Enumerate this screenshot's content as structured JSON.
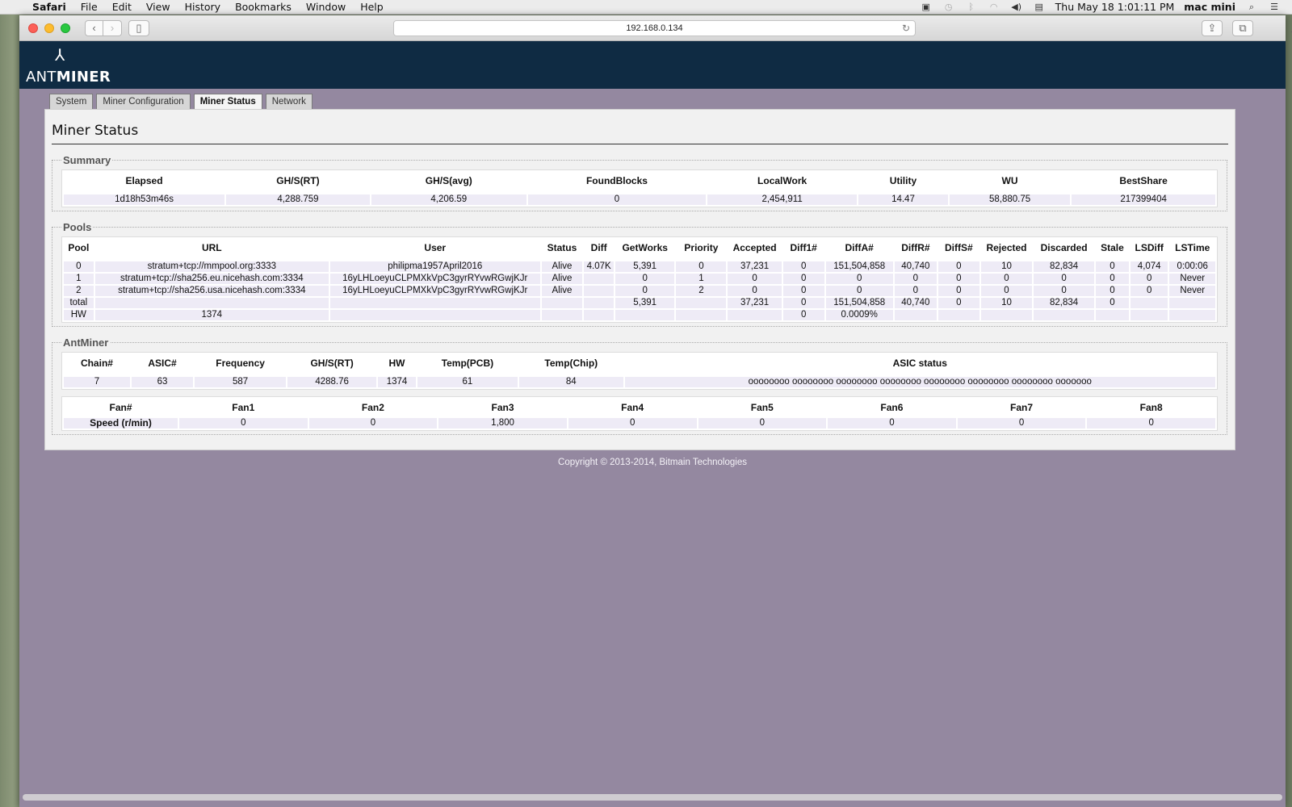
{
  "menubar": {
    "app": "Safari",
    "items": [
      "File",
      "Edit",
      "View",
      "History",
      "Bookmarks",
      "Window",
      "Help"
    ],
    "clock": "Thu May 18  1:01:11 PM",
    "user": "mac mini"
  },
  "browser": {
    "url": "192.168.0.134"
  },
  "nav": {
    "tabs": [
      "System",
      "Miner Configuration",
      "Miner Status",
      "Network"
    ],
    "active": "Miner Status"
  },
  "logo": {
    "mark": "⅄",
    "word_a": "ANT",
    "word_b": "MINER"
  },
  "page": {
    "title": "Miner Status",
    "summary": {
      "legend": "Summary",
      "headers": [
        "Elapsed",
        "GH/S(RT)",
        "GH/S(avg)",
        "FoundBlocks",
        "LocalWork",
        "Utility",
        "WU",
        "BestShare"
      ],
      "row": [
        "1d18h53m46s",
        "4,288.759",
        "4,206.59",
        "0",
        "2,454,911",
        "14.47",
        "58,880.75",
        "217399404"
      ]
    },
    "pools": {
      "legend": "Pools",
      "headers": [
        "Pool",
        "URL",
        "User",
        "Status",
        "Diff",
        "GetWorks",
        "Priority",
        "Accepted",
        "Diff1#",
        "DiffA#",
        "DiffR#",
        "DiffS#",
        "Rejected",
        "Discarded",
        "Stale",
        "LSDiff",
        "LSTime"
      ],
      "rows": [
        [
          "0",
          "stratum+tcp://mmpool.org:3333",
          "philipma1957April2016",
          "Alive",
          "4.07K",
          "5,391",
          "0",
          "37,231",
          "0",
          "151,504,858",
          "40,740",
          "0",
          "10",
          "82,834",
          "0",
          "4,074",
          "0:00:06"
        ],
        [
          "1",
          "stratum+tcp://sha256.eu.nicehash.com:3334",
          "16yLHLoeyuCLPMXkVpC3gyrRYvwRGwjKJr",
          "Alive",
          "",
          "0",
          "1",
          "0",
          "0",
          "0",
          "0",
          "0",
          "0",
          "0",
          "0",
          "0",
          "Never"
        ],
        [
          "2",
          "stratum+tcp://sha256.usa.nicehash.com:3334",
          "16yLHLoeyuCLPMXkVpC3gyrRYvwRGwjKJr",
          "Alive",
          "",
          "0",
          "2",
          "0",
          "0",
          "0",
          "0",
          "0",
          "0",
          "0",
          "0",
          "0",
          "Never"
        ],
        [
          "total",
          "",
          "",
          "",
          "",
          "5,391",
          "",
          "37,231",
          "0",
          "151,504,858",
          "40,740",
          "0",
          "10",
          "82,834",
          "0",
          "",
          ""
        ],
        [
          "HW",
          "1374",
          "",
          "",
          "",
          "",
          "",
          "",
          "0",
          "0.0009%",
          "",
          "",
          "",
          "",
          "",
          "",
          ""
        ]
      ]
    },
    "antminer": {
      "legend": "AntMiner",
      "headers": [
        "Chain#",
        "ASIC#",
        "Frequency",
        "GH/S(RT)",
        "HW",
        "Temp(PCB)",
        "Temp(Chip)",
        "ASIC status"
      ],
      "row": [
        "7",
        "63",
        "587",
        "4288.76",
        "1374",
        "61",
        "84",
        "oooooooo oooooooo oooooooo oooooooo oooooooo oooooooo oooooooo ooooooo"
      ],
      "fan_headers": [
        "Fan#",
        "Fan1",
        "Fan2",
        "Fan3",
        "Fan4",
        "Fan5",
        "Fan6",
        "Fan7",
        "Fan8"
      ],
      "fan_row": [
        "Speed (r/min)",
        "0",
        "0",
        "1,800",
        "0",
        "0",
        "0",
        "0",
        "0"
      ]
    },
    "copyright": "Copyright © 2013-2014, Bitmain Technologies"
  }
}
